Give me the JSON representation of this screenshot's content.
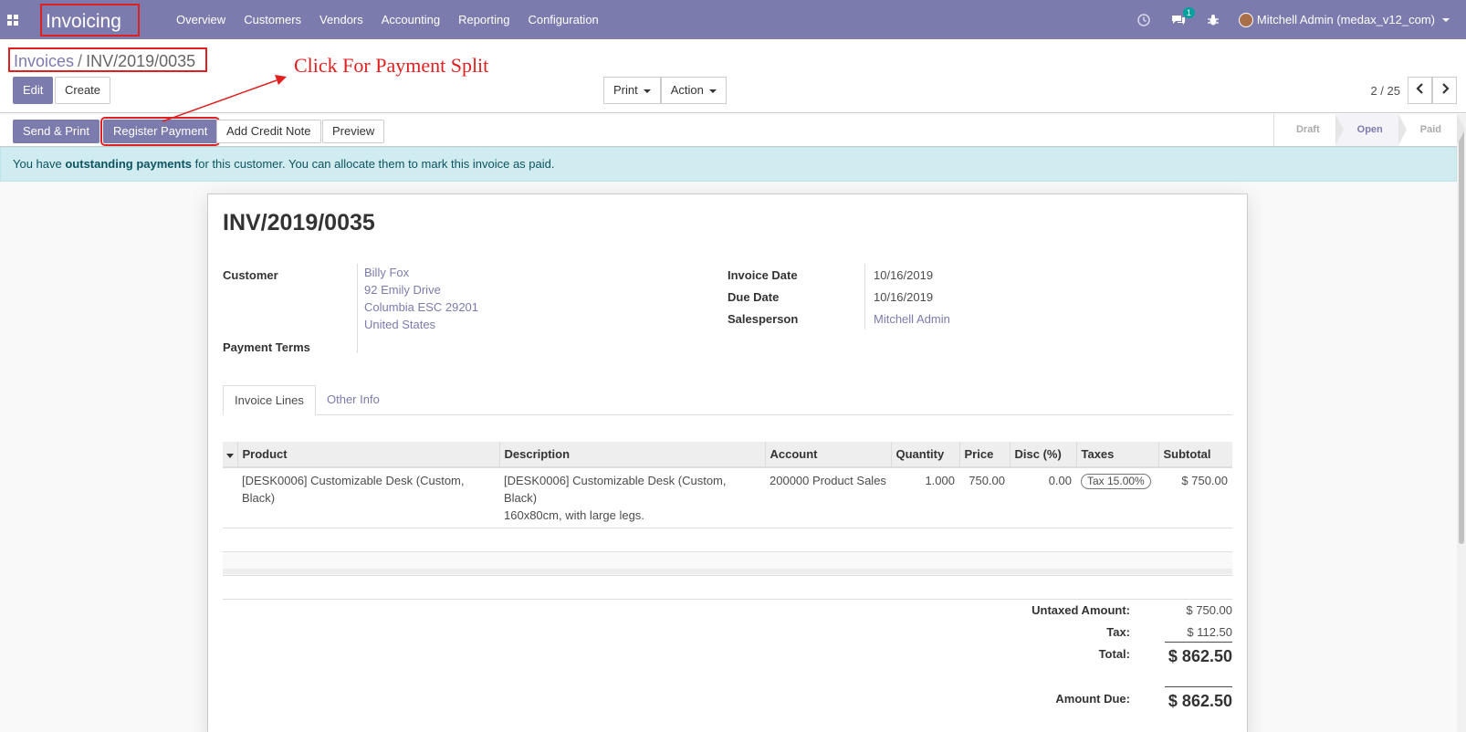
{
  "navbar": {
    "app_name": "Invoicing",
    "menu": [
      "Overview",
      "Customers",
      "Vendors",
      "Accounting",
      "Reporting",
      "Configuration"
    ],
    "chat_badge": "1",
    "user": "Mitchell Admin (medax_v12_com)",
    "accent_color": "#7c7bad"
  },
  "breadcrumb": {
    "parent": "Invoices",
    "separator": "/",
    "current": "INV/2019/0035"
  },
  "annotation": {
    "text": "Click For Payment Split",
    "color": "#e02020"
  },
  "buttons": {
    "edit": "Edit",
    "create": "Create",
    "print": "Print",
    "action": "Action",
    "send_print": "Send & Print",
    "register_payment": "Register Payment",
    "add_credit_note": "Add Credit Note",
    "preview": "Preview"
  },
  "pager": {
    "value": "2 / 25"
  },
  "stages": [
    "Draft",
    "Open",
    "Paid"
  ],
  "active_stage": "Open",
  "alert": {
    "prefix": "You have ",
    "bold": "outstanding payments",
    "suffix": " for this customer. You can allocate them to mark this invoice as paid."
  },
  "invoice": {
    "number": "INV/2019/0035",
    "labels": {
      "customer": "Customer",
      "payment_terms": "Payment Terms",
      "invoice_date": "Invoice Date",
      "due_date": "Due Date",
      "salesperson": "Salesperson"
    },
    "customer_address": [
      "Billy Fox",
      "92 Emily Drive",
      "Columbia ESC 29201",
      "United States"
    ],
    "invoice_date": "10/16/2019",
    "due_date": "10/16/2019",
    "salesperson": "Mitchell Admin"
  },
  "tabs": [
    "Invoice Lines",
    "Other Info"
  ],
  "table": {
    "headers": [
      "Product",
      "Description",
      "Account",
      "Quantity",
      "Price",
      "Disc (%)",
      "Taxes",
      "Subtotal"
    ],
    "rows": [
      {
        "product": "[DESK0006] Customizable Desk (Custom, Black)",
        "description_1": "[DESK0006] Customizable Desk (Custom, Black)",
        "description_2": "160x80cm, with large legs.",
        "account": "200000 Product Sales",
        "quantity": "1.000",
        "price": "750.00",
        "discount": "0.00",
        "taxes": "Tax 15.00%",
        "subtotal": "$ 750.00"
      }
    ]
  },
  "totals": {
    "untaxed_label": "Untaxed Amount:",
    "untaxed": "$ 750.00",
    "tax_label": "Tax:",
    "tax": "$ 112.50",
    "total_label": "Total:",
    "total": "$ 862.50",
    "due_label": "Amount Due:",
    "due": "$ 862.50"
  }
}
